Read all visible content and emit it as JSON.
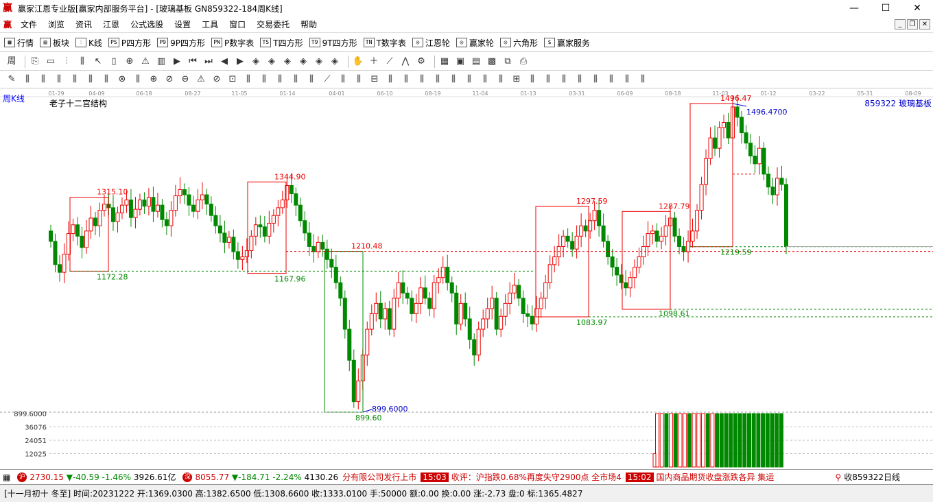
{
  "window": {
    "title": "赢家江恩专业版[赢家内部服务平台] - [玻璃基板  GN859322-184周K线]",
    "logo": "赢",
    "min": "—",
    "max": "☐",
    "close": "✕"
  },
  "menu": {
    "logo": "赢",
    "items": [
      "文件",
      "浏览",
      "资讯",
      "江恩",
      "公式选股",
      "设置",
      "工具",
      "窗口",
      "交易委托",
      "帮助"
    ]
  },
  "toolbar1": [
    {
      "icon": "▦",
      "label": "行情"
    },
    {
      "icon": "▤",
      "label": "板块"
    },
    {
      "icon": "⫶",
      "label": "K线"
    },
    {
      "icon": "PS",
      "label": "P四方形"
    },
    {
      "icon": "P9",
      "label": "9P四方形"
    },
    {
      "icon": "PN",
      "label": "P数字表"
    },
    {
      "icon": "TS",
      "label": "T四方形"
    },
    {
      "icon": "T9",
      "label": "9T四方形"
    },
    {
      "icon": "TN",
      "label": "T数字表"
    },
    {
      "icon": "◎",
      "label": "江恩轮"
    },
    {
      "icon": "◎",
      "label": "赢家轮"
    },
    {
      "icon": "◎",
      "label": "六角形"
    },
    {
      "icon": "$",
      "label": "赢家服务"
    }
  ],
  "chart_data": {
    "type": "candlestick",
    "period_label": "周K线",
    "indicator_label": "老子十二宫结构",
    "symbol_label": "859322  玻璃基板",
    "date_ticks": [
      "01-29",
      "04-09",
      "06-18",
      "08-27",
      "11-05",
      "01-14",
      "04-01",
      "06-10",
      "08-19",
      "11-04",
      "01-13",
      "03-31",
      "06-09",
      "08-18",
      "11-03",
      "01-12",
      "03-22",
      "05-31",
      "08-09"
    ],
    "price_labels": {
      "high_max": "1496.47",
      "high_max_line": "1496.4700",
      "low_min": "899.60",
      "low_min_line": "899.6000",
      "box1_high": "1315.10",
      "box1_low": "1172.28",
      "box2_high": "1344.90",
      "box2_low": "1167.96",
      "level_1210": "1210.48",
      "box3_high": "1297.59",
      "box3_low": "1083.97",
      "box4_high": "1287.79",
      "box4_low": "1098.61",
      "box5_low": "1219.59"
    },
    "ylim": [
      899.6,
      1496.47
    ],
    "volume_axis": [
      "899.6000",
      "36076",
      "24051",
      "12025"
    ],
    "vol_ylim": [
      0,
      48101
    ]
  },
  "status1": {
    "idx1_value": "2730.15",
    "idx1_change": "▼-40.59",
    "idx1_pct": "-1.46%",
    "idx1_amount": "3926.61亿",
    "idx2_icon": "深",
    "idx2_value": "8055.77",
    "idx2_change": "▼-184.71",
    "idx2_pct": "-2.24%",
    "idx2_amount": "4130.26",
    "news1": "分有限公司发行上市",
    "time1": "15:03",
    "news2": "收评：沪指跌0.68%再度失守2900点 全市场4",
    "time2": "15:02",
    "news3": "国内商品期货收盘涨跌各异 集运",
    "right": "收859322日线"
  },
  "status2": {
    "text": "[十一月初十 冬至] 时间:20231222 开:1369.0300 高:1382.6500 低:1308.6600 收:1333.0100 手:50000 额:0.00 换:0.00 涨:-2.73 盘:0 标:1365.4827"
  }
}
